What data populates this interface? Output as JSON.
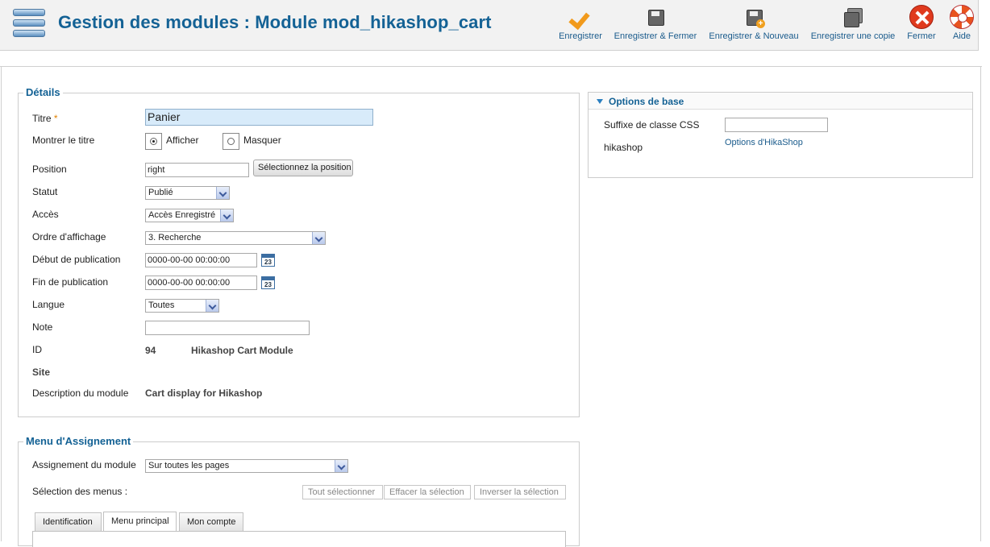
{
  "header": {
    "title": "Gestion des modules : Module mod_hikashop_cart",
    "toolbar": [
      {
        "label": "Enregistrer",
        "icon": "check-icon"
      },
      {
        "label": "Enregistrer & Fermer",
        "icon": "save-icon"
      },
      {
        "label": "Enregistrer & Nouveau",
        "icon": "save-new-icon"
      },
      {
        "label": "Enregistrer une copie",
        "icon": "copy-icon"
      },
      {
        "label": "Fermer",
        "icon": "close-icon"
      },
      {
        "label": "Aide",
        "icon": "help-icon"
      }
    ]
  },
  "details": {
    "legend": "Détails",
    "titre_label": "Titre",
    "required_mark": "*",
    "titre_value": "Panier",
    "show_title_label": "Montrer le titre",
    "show_title_options": [
      "Afficher",
      "Masquer"
    ],
    "show_title_selected": "Afficher",
    "position_label": "Position",
    "position_value": "right",
    "position_button": "Sélectionnez la position",
    "statut_label": "Statut",
    "statut_value": "Publié",
    "acces_label": "Accès",
    "acces_value": "Accès Enregistré",
    "ordre_label": "Ordre d'affichage",
    "ordre_value": "3. Recherche",
    "debut_label": "Début de publication",
    "debut_value": "0000-00-00 00:00:00",
    "fin_label": "Fin de publication",
    "fin_value": "0000-00-00 00:00:00",
    "calendar_day": "23",
    "langue_label": "Langue",
    "langue_value": "Toutes",
    "note_label": "Note",
    "note_value": "",
    "id_label": "ID",
    "id_value": "94",
    "module_name": "Hikashop Cart Module",
    "site_label": "Site",
    "description_label": "Description du module",
    "description_value": "Cart display for Hikashop"
  },
  "menu_assignment": {
    "legend": "Menu d'Assignement",
    "assignment_label": "Assignement du module",
    "assignment_value": "Sur toutes les pages",
    "selection_label": "Sélection des menus :",
    "buttons": [
      "Tout sélectionner",
      "Effacer la sélection",
      "Inverser la sélection"
    ],
    "tabs": [
      "Identification",
      "Menu principal",
      "Mon compte"
    ],
    "active_tab": "Menu principal"
  },
  "options": {
    "title": "Options de base",
    "css_suffix_label": "Suffixe de classe CSS",
    "css_suffix_value": "",
    "hikashop_label": "hikashop",
    "hikashop_link": "Options d'HikaShop"
  },
  "colors": {
    "title_blue": "#146295",
    "accent_orange": "#f19a1c",
    "close_red": "#e03a1e"
  }
}
